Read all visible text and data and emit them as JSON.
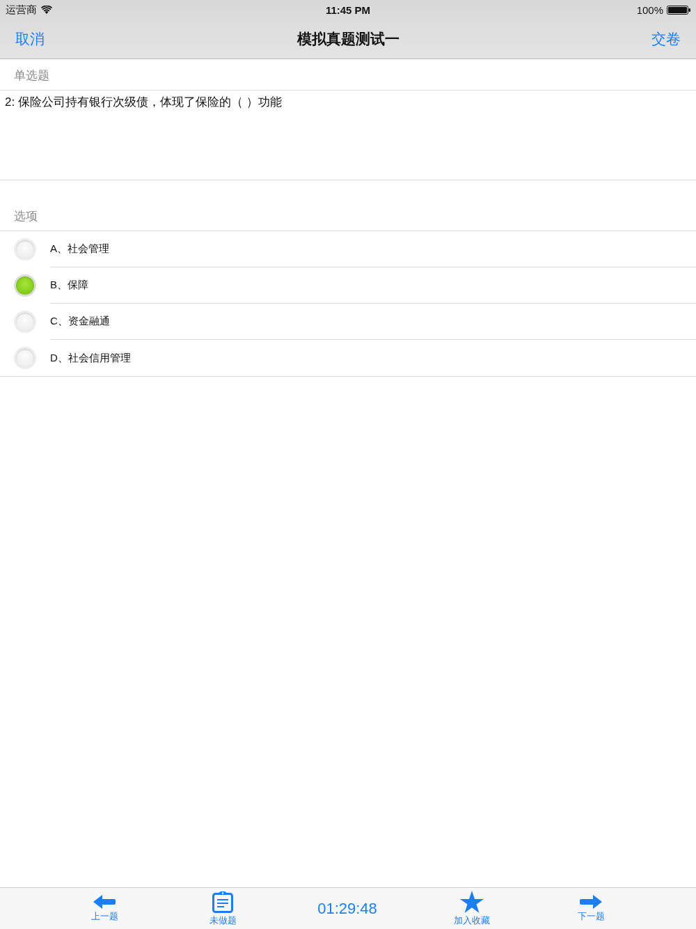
{
  "status_bar": {
    "carrier": "运营商",
    "time": "11:45 PM",
    "battery": "100%"
  },
  "nav_bar": {
    "cancel": "取消",
    "title": "模拟真题测试一",
    "submit": "交卷"
  },
  "question": {
    "type_label": "单选题",
    "text": "2: 保险公司持有银行次级债，体现了保险的（ ）功能"
  },
  "options_section": {
    "header": "选项",
    "options": [
      {
        "label": "A、社会管理",
        "selected": false
      },
      {
        "label": "B、保障",
        "selected": true
      },
      {
        "label": "C、资金融通",
        "selected": false
      },
      {
        "label": "D、社会信用管理",
        "selected": false
      }
    ]
  },
  "toolbar": {
    "previous": {
      "label": "上一题"
    },
    "unanswered": {
      "label": "未做题"
    },
    "timer": "01:29:48",
    "favorite": {
      "label": "加入收藏"
    },
    "next": {
      "label": "下一题"
    }
  }
}
